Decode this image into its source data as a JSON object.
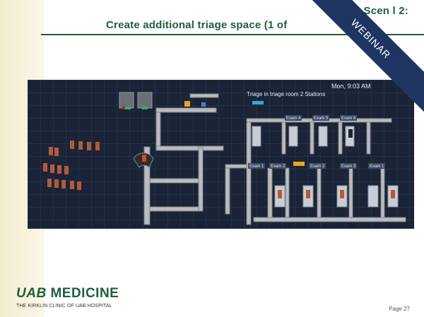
{
  "slide": {
    "title_line1": "Scen      l 2:",
    "title_line2": "Create additional triage space (1 of",
    "page": "Page 27"
  },
  "simulation": {
    "time": "Mon, 9:03 AM",
    "status": "Triage in triage room  2 Stations",
    "room_labels": [
      "Exam 4",
      "Exam 5",
      "Exam 6",
      "Exam 1",
      "Exam 2",
      "Exam 3",
      "Exam 1",
      "Exam 2"
    ]
  },
  "branding": {
    "logo_uab": "UAB",
    "logo_medicine": "MEDICINE",
    "subtitle": "THE KIRKLIN CLINIC OF UAB HOSPITAL"
  },
  "ribbon": {
    "label": "WEBINAR"
  },
  "colors": {
    "title_green": "#1f5e3c",
    "ribbon_navy": "#1f3561",
    "sim_background": "#1a2436"
  }
}
